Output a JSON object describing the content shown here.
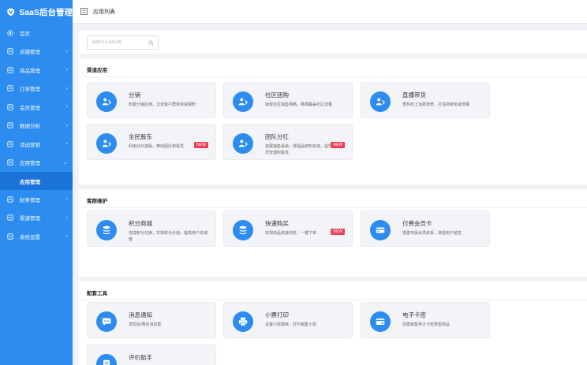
{
  "brand": {
    "title": "SaaS后台管理"
  },
  "colors": {
    "accent": "#2d8cf0",
    "badge": "#ed4056"
  },
  "sidebar": {
    "items": [
      {
        "label": "首页",
        "icon": "home-icon",
        "arrow": ""
      },
      {
        "label": "店铺管理",
        "icon": "shop-icon",
        "arrow": "›"
      },
      {
        "label": "商品管理",
        "icon": "goods-icon",
        "arrow": "›"
      },
      {
        "label": "订单管理",
        "icon": "order-icon",
        "arrow": "›"
      },
      {
        "label": "会员管理",
        "icon": "member-icon",
        "arrow": "›"
      },
      {
        "label": "数据分析",
        "icon": "chart-icon",
        "arrow": "›"
      },
      {
        "label": "活动营销",
        "icon": "activity-icon",
        "arrow": "›"
      },
      {
        "label": "应用管理",
        "icon": "app-icon",
        "arrow": "⌄"
      },
      {
        "label": "财务管理",
        "icon": "finance-icon",
        "arrow": "›"
      },
      {
        "label": "渠道管理",
        "icon": "channel-icon",
        "arrow": "›"
      },
      {
        "label": "系统设置",
        "icon": "settings-icon",
        "arrow": "›"
      }
    ],
    "sub_item": "应用管理"
  },
  "header": {
    "title": "应用列表"
  },
  "search": {
    "placeholder": "请填写应用名称"
  },
  "new_label": "NEW",
  "sections": [
    {
      "title": "渠道应用",
      "cards": [
        {
          "name": "分销",
          "desc": "刺激分销应用，沉淀客户群体快速裂盼",
          "icon": "distribution-icon",
          "new": false
        },
        {
          "name": "社区团购",
          "desc": "锁建社区销售网络，精准覆盖社区流量",
          "icon": "group-buy-icon",
          "new": false
        },
        {
          "name": "直播带货",
          "desc": "重构线上消费场景，打造商家私域流量",
          "icon": "live-stream-icon",
          "new": false
        },
        {
          "name": "全民股东",
          "desc": "利用分红激励，带动团队积极性",
          "icon": "shareholder-icon",
          "new": true
        },
        {
          "name": "团队分红",
          "desc": "拓展销售渠道，增强品牌知名度，提升团队成员管理积极性",
          "icon": "team-bonus-icon",
          "new": true
        }
      ]
    },
    {
      "title": "客群维护",
      "cards": [
        {
          "name": "积分商城",
          "desc": "完成积分兑换，实现积分价值，提高用户忠诚度",
          "icon": "points-mall-icon",
          "new": false
        },
        {
          "name": "快速购买",
          "desc": "实现商品快速浏览、一键下单",
          "icon": "quick-buy-icon",
          "new": true
        },
        {
          "name": "付费会员卡",
          "desc": "搭建专属会员体系，增强用户粘性",
          "icon": "member-card-icon",
          "new": false
        }
      ]
    },
    {
      "title": "配套工具",
      "cards": [
        {
          "name": "消息通知",
          "desc": "发短信/微信消息案",
          "icon": "message-icon",
          "new": false
        },
        {
          "name": "小票打印",
          "desc": "设置小票模板，打印销售小票",
          "icon": "printer-icon",
          "new": false
        },
        {
          "name": "电子卡密",
          "desc": "创建销售电子卡密类型商品",
          "icon": "e-card-icon",
          "new": false
        },
        {
          "name": "评价助手",
          "desc": "",
          "icon": "review-icon",
          "new": false
        }
      ]
    }
  ]
}
